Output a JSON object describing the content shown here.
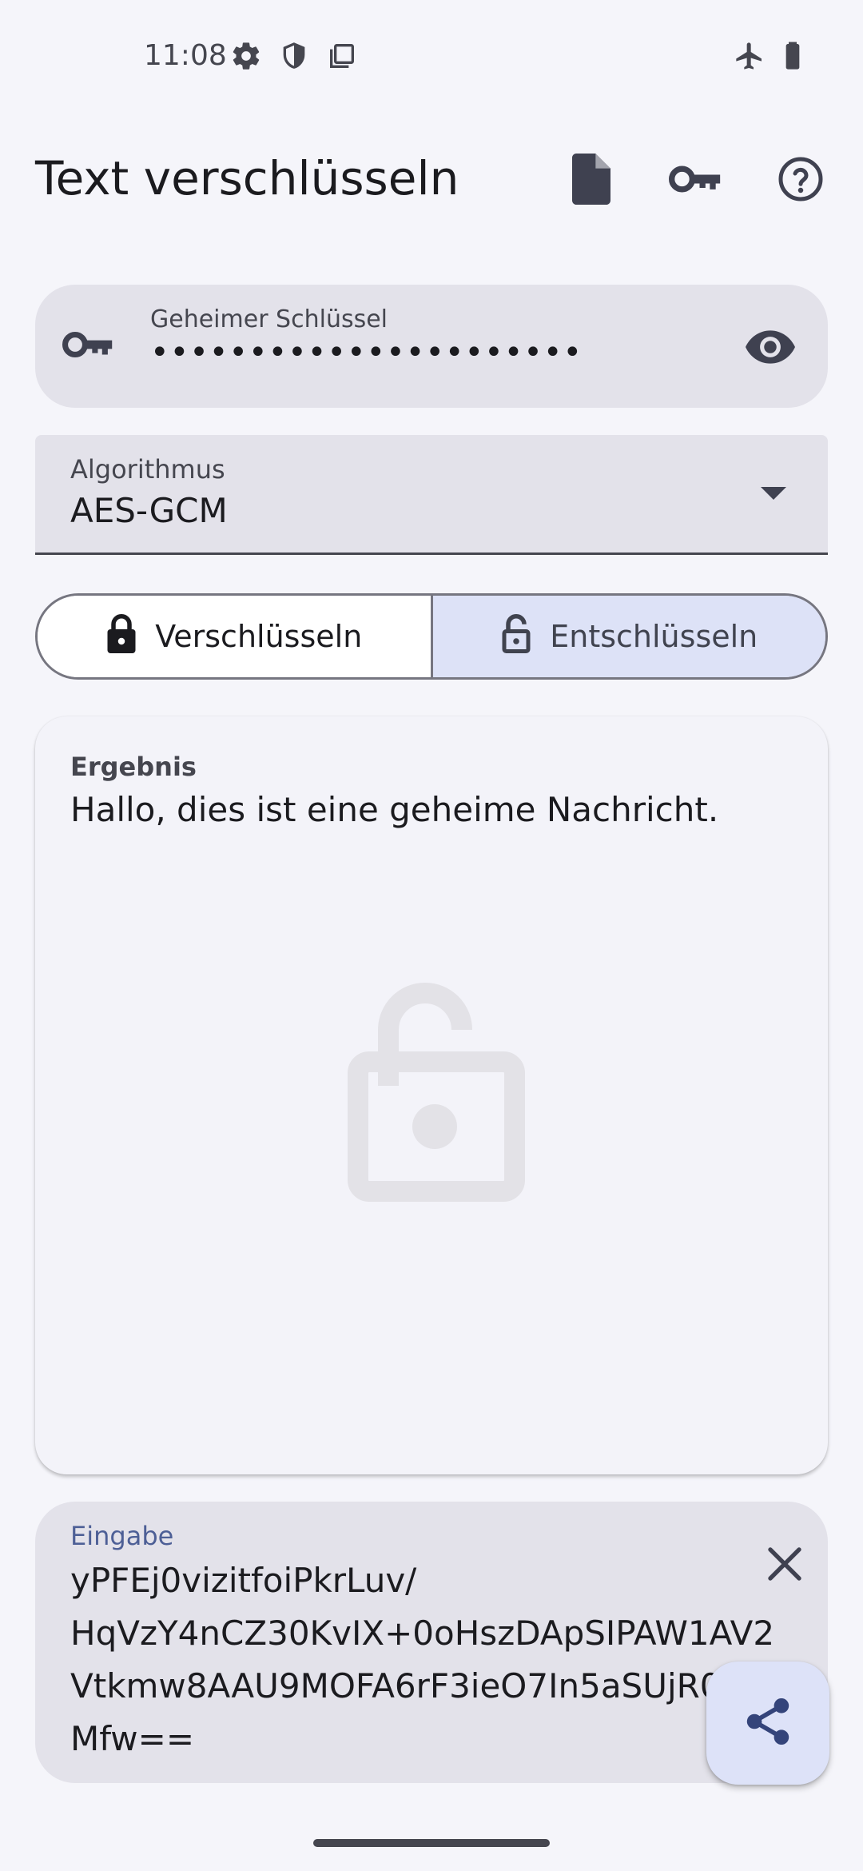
{
  "status_bar": {
    "time": "11:08",
    "left_icons": [
      "gear-icon",
      "shield-icon",
      "copy-icon"
    ],
    "right_icons": [
      "airplane-icon",
      "battery-icon"
    ]
  },
  "top_bar": {
    "title": "Text verschlüsseln",
    "actions": [
      "file-icon",
      "key-icon",
      "help-icon"
    ]
  },
  "key_field": {
    "label": "Geheimer Schlüssel",
    "value": "••••••••••••••••••••••",
    "leading_icon": "key-icon",
    "trailing_icon": "eye-icon"
  },
  "algorithm": {
    "label": "Algorithmus",
    "value": "AES-GCM"
  },
  "mode": {
    "encrypt_label": "Verschlüsseln",
    "decrypt_label": "Entschlüsseln",
    "selected": "decrypt"
  },
  "result": {
    "label": "Ergebnis",
    "value": "Hallo, dies ist eine geheime Nachricht.",
    "watermark_icon": "lock-open-icon"
  },
  "input": {
    "label": "Eingabe",
    "lines": [
      "yPFEj0vizitfoiPkrLuv/",
      "HqVzY4nCZ30KvIX+0oHszDApSIPAW1AV2",
      "Vtkmw8AAU9MOFA6rF3ieO7In5aSUjR0",
      "Mfw=="
    ]
  },
  "colors": {
    "background": "#f5f5fa",
    "surface_variant": "#e3e2ea",
    "selected_segment": "#dde2f7",
    "accent": "#4d5f96",
    "fab": "#dde2f8"
  }
}
